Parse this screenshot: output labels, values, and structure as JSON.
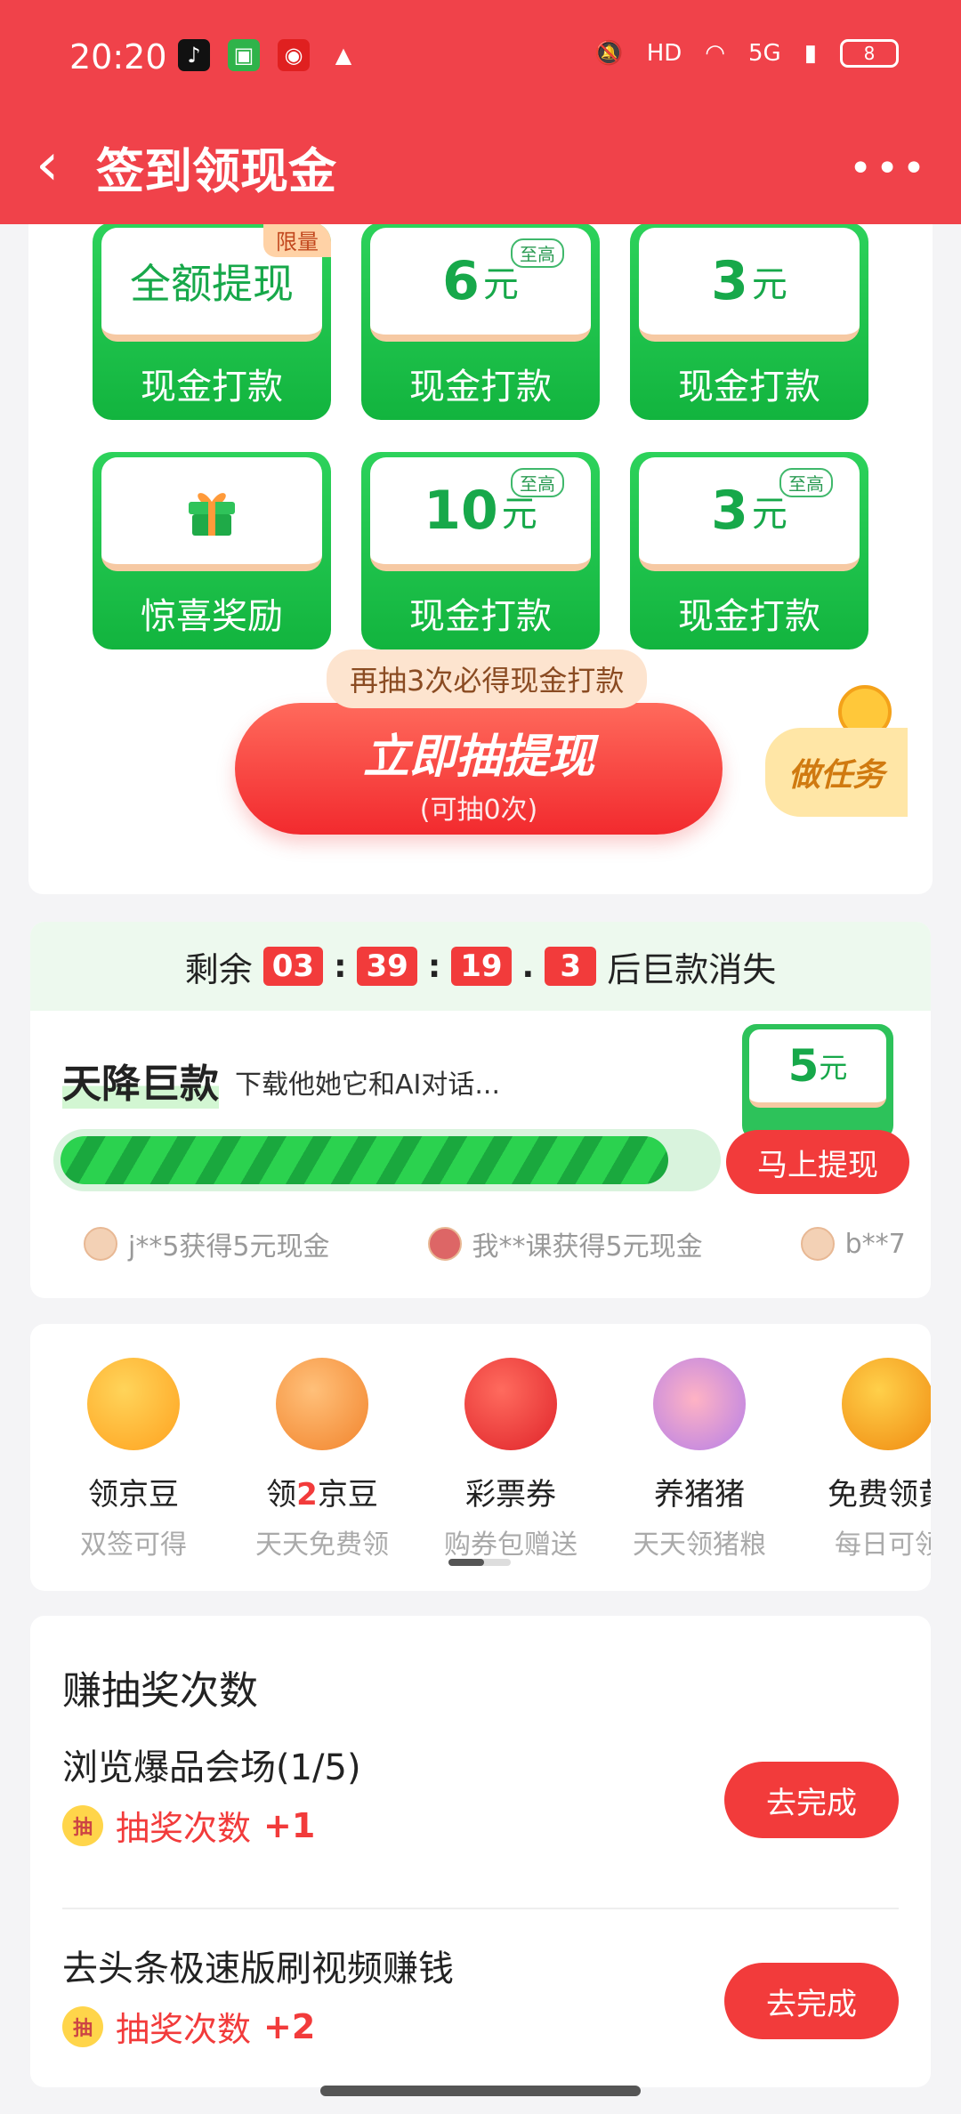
{
  "status": {
    "time": "20:20",
    "battery": "8",
    "net_label": "5G",
    "hd_label": "HD"
  },
  "navbar": {
    "back_glyph": "‹",
    "title": "签到领现金",
    "more_glyph": "•••"
  },
  "lottery": {
    "prizes": [
      {
        "top_text": "全额提现",
        "tag": "限量",
        "bottom": "现金打款"
      },
      {
        "amount": "6",
        "unit": "元",
        "badge": "至高",
        "bottom": "现金打款"
      },
      {
        "amount": "3",
        "unit": "元",
        "bottom": "现金打款"
      },
      {
        "icon": "gift-icon",
        "bottom": "惊喜奖励"
      },
      {
        "amount": "10",
        "unit": "元",
        "badge": "至高",
        "bottom": "现金打款"
      },
      {
        "amount": "3",
        "unit": "元",
        "badge": "至高",
        "bottom": "现金打款"
      }
    ],
    "hint": "再抽3次必得现金打款",
    "draw_button": "立即抽提现",
    "draw_remaining": "(可抽0次)",
    "task_chip": "做任务"
  },
  "countdown": {
    "prefix": "剩余",
    "hours": "03",
    "minutes": "39",
    "seconds": "19",
    "tenths": "3",
    "suffix": "后巨款消失",
    "sep_colon": ":",
    "sep_dot": "."
  },
  "jackpot": {
    "title": "天降巨款",
    "subtitle": "下载他她它和AI对话...",
    "prize_amount": "5",
    "prize_unit": "元",
    "progress": 0.93,
    "withdraw_button": "马上提现",
    "ticker": [
      "j**5获得5元现金",
      "我**课获得5元现金",
      "b**7"
    ]
  },
  "icons": [
    {
      "label": "领京豆",
      "sub": "双签可得",
      "icon": "duck-icon",
      "color": "#ffb21f"
    },
    {
      "label_pre": "领",
      "label_red": "2",
      "label_post": "京豆",
      "sub": "天天免费领",
      "icon": "beans-icon",
      "color": "#f59a3c"
    },
    {
      "label": "彩票券",
      "sub": "购券包赠送",
      "icon": "lottery-ball-icon",
      "color": "#f23b3b"
    },
    {
      "label": "养猪猪",
      "sub": "天天领猪粮",
      "icon": "pig-icon",
      "color": "#c089e8"
    },
    {
      "label": "免费领黄",
      "sub": "每日可领",
      "icon": "gold-icon",
      "color": "#f6a21a"
    }
  ],
  "tasks": {
    "title": "赚抽奖次数",
    "reward_icon": "抽",
    "items": [
      {
        "name": "浏览爆品会场(1/5)",
        "reward_label": "抽奖次数",
        "reward_value": "+1",
        "button": "去完成"
      },
      {
        "name": "去头条极速版刷视频赚钱",
        "reward_label": "抽奖次数",
        "reward_value": "+2",
        "button": "去完成"
      }
    ]
  }
}
